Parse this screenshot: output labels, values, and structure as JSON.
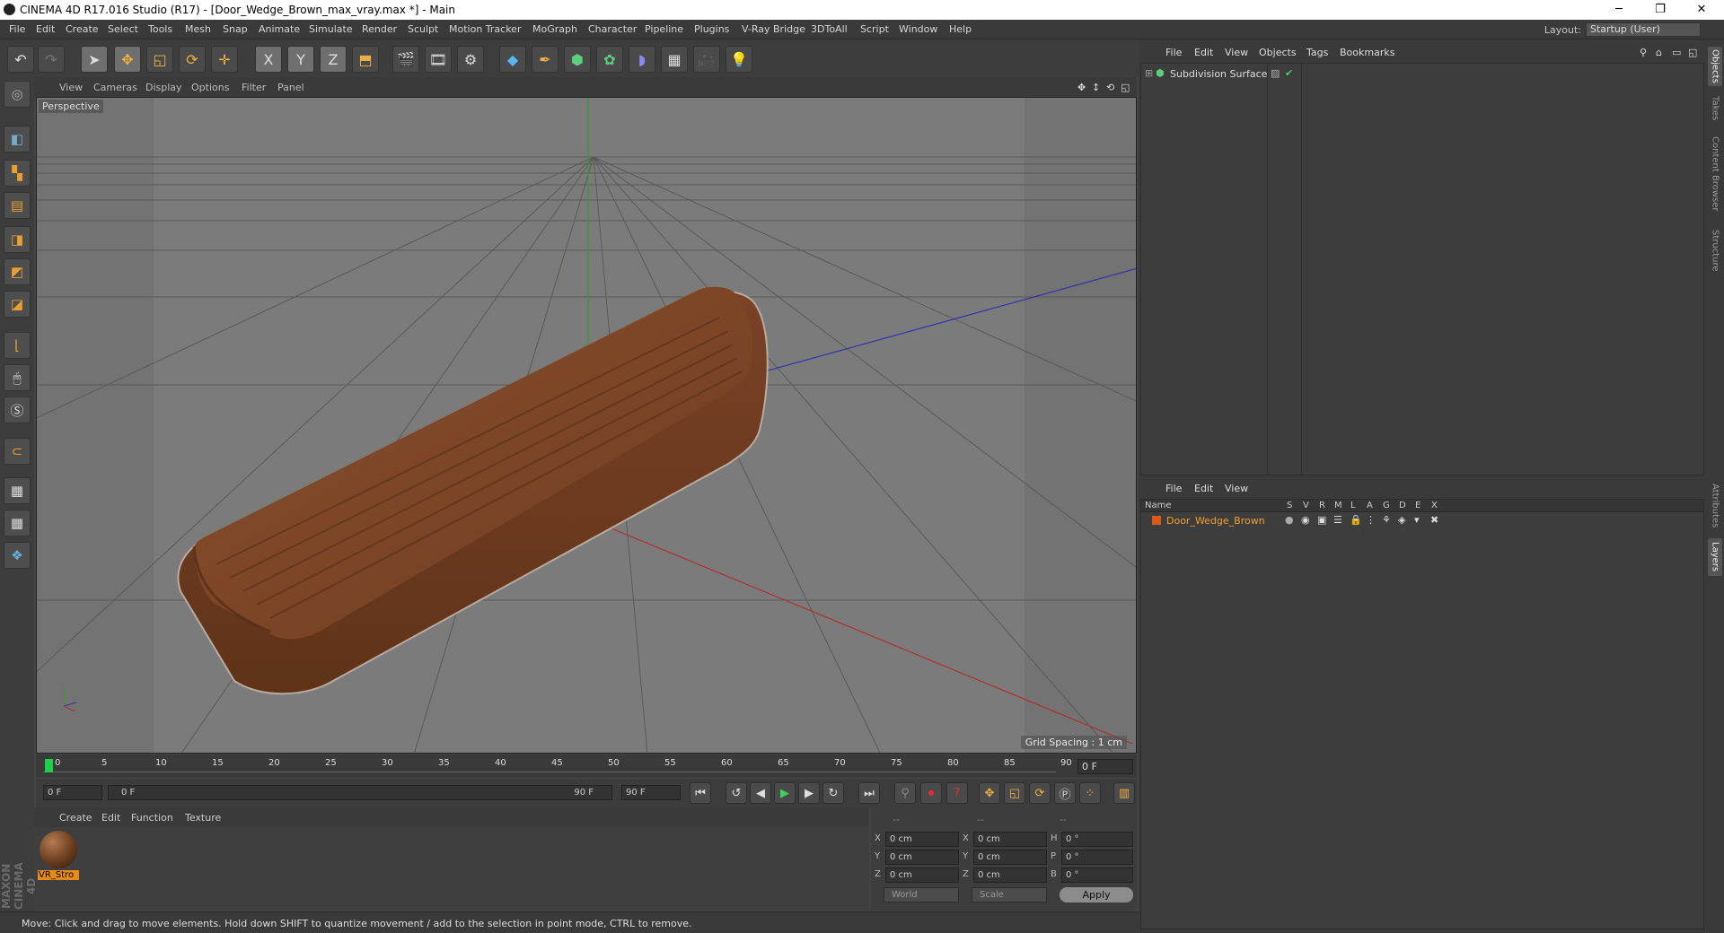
{
  "window": {
    "title": "CINEMA 4D R17.016 Studio (R17) - [Door_Wedge_Brown_max_vray.max *] - Main",
    "minimize": "─",
    "maximize": "❐",
    "close": "✕"
  },
  "menubar": {
    "items": [
      "File",
      "Edit",
      "Create",
      "Select",
      "Tools",
      "Mesh",
      "Snap",
      "Animate",
      "Simulate",
      "Render",
      "Sculpt",
      "Motion Tracker",
      "MoGraph",
      "Character",
      "Pipeline",
      "Plugins",
      "V-Ray Bridge",
      "3DToAll",
      "Script",
      "Window",
      "Help"
    ],
    "layout_label": "Layout:",
    "layout_value": "Startup (User)"
  },
  "toolbar": {
    "icons": [
      "undo-icon",
      "redo-icon",
      "select-arrow-icon",
      "move-icon",
      "scale-icon",
      "rotate-icon",
      "live-move-icon",
      "x-axis-icon",
      "y-axis-icon",
      "z-axis-icon",
      "coordinate-system-icon",
      "render-view-icon",
      "render-picture-viewer-icon",
      "render-settings-icon",
      "cube-icon",
      "pen-icon",
      "subdivision-icon",
      "array-icon",
      "deformer-icon",
      "floor-icon",
      "camera-icon",
      "light-icon"
    ],
    "glyphs": {
      "x": "X",
      "y": "Y",
      "z": "Z"
    }
  },
  "viewport": {
    "menu": [
      "View",
      "Cameras",
      "Display",
      "Options",
      "Filter",
      "Panel"
    ],
    "label": "Perspective",
    "grid_spacing": "Grid Spacing : 1 cm",
    "colors": {
      "background": "#7b7b7b",
      "y_axis": "#2e9e2e",
      "x_axis": "#b03030",
      "z_axis": "#3333aa",
      "wedge": "#7a4428"
    }
  },
  "timeline": {
    "ticks": [
      "0",
      "5",
      "10",
      "15",
      "20",
      "25",
      "30",
      "35",
      "40",
      "45",
      "50",
      "55",
      "60",
      "65",
      "70",
      "75",
      "80",
      "85",
      "90"
    ],
    "current_frame": "0 F"
  },
  "transport": {
    "start_field": "0 F",
    "range_start": "0 F",
    "range_end": "90 F",
    "end_field": "90 F"
  },
  "material_manager": {
    "menu": [
      "Create",
      "Edit",
      "Function",
      "Texture"
    ],
    "material_name": "VR_Stro"
  },
  "coordinates": {
    "headers": [
      "--",
      "--",
      "--"
    ],
    "rows": [
      {
        "a": "X",
        "av": "0 cm",
        "b": "X",
        "bv": "0 cm",
        "c": "H",
        "cv": "0 °"
      },
      {
        "a": "Y",
        "av": "0 cm",
        "b": "Y",
        "bv": "0 cm",
        "c": "P",
        "cv": "0 °"
      },
      {
        "a": "Z",
        "av": "0 cm",
        "b": "Z",
        "bv": "0 cm",
        "c": "B",
        "cv": "0 °"
      }
    ],
    "mode": "World",
    "scale_mode": "Scale",
    "apply": "Apply"
  },
  "object_manager": {
    "menu": [
      "File",
      "Edit",
      "View",
      "Objects",
      "Tags",
      "Bookmarks"
    ],
    "objects": [
      {
        "name": "Subdivision Surface",
        "check": "✔"
      }
    ]
  },
  "layer_manager": {
    "menu": [
      "File",
      "Edit",
      "View"
    ],
    "columns": [
      "Name",
      "S",
      "V",
      "R",
      "M",
      "L",
      "A",
      "G",
      "D",
      "E",
      "X"
    ],
    "layers": [
      {
        "name": "Door_Wedge_Brown",
        "color": "#e0591a"
      }
    ]
  },
  "side_tabs": [
    "Objects",
    "Takes",
    "Content Browser",
    "Structure",
    "Attributes",
    "Layers"
  ],
  "status": "Move: Click and drag to move elements. Hold down SHIFT to quantize movement / add to the selection in point mode, CTRL to remove.",
  "brand": "MAXON CINEMA 4D"
}
